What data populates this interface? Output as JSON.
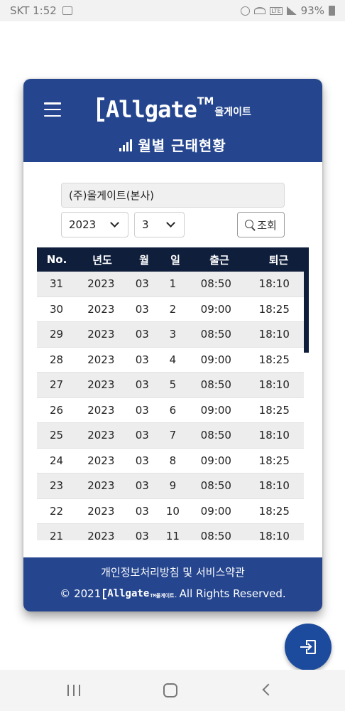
{
  "status_bar": {
    "carrier_time": "SKT 1:52",
    "battery": "93%"
  },
  "header": {
    "logo_text": "Allgate",
    "logo_tm": "TM",
    "logo_kr": "올게이트",
    "title": "월별 근태현황"
  },
  "form": {
    "company": "(주)올게이트(본사)",
    "year": "2023",
    "month": "3",
    "search_label": "조회"
  },
  "table": {
    "columns": [
      "No.",
      "년도",
      "월",
      "일",
      "출근",
      "퇴근"
    ],
    "rows": [
      [
        "31",
        "2023",
        "03",
        "1",
        "08:50",
        "18:10"
      ],
      [
        "30",
        "2023",
        "03",
        "2",
        "09:00",
        "18:25"
      ],
      [
        "29",
        "2023",
        "03",
        "3",
        "08:50",
        "18:10"
      ],
      [
        "28",
        "2023",
        "03",
        "4",
        "09:00",
        "18:25"
      ],
      [
        "27",
        "2023",
        "03",
        "5",
        "08:50",
        "18:10"
      ],
      [
        "26",
        "2023",
        "03",
        "6",
        "09:00",
        "18:25"
      ],
      [
        "25",
        "2023",
        "03",
        "7",
        "08:50",
        "18:10"
      ],
      [
        "24",
        "2023",
        "03",
        "8",
        "09:00",
        "18:25"
      ],
      [
        "23",
        "2023",
        "03",
        "9",
        "08:50",
        "18:10"
      ],
      [
        "22",
        "2023",
        "03",
        "10",
        "09:00",
        "18:25"
      ],
      [
        "21",
        "2023",
        "03",
        "11",
        "08:50",
        "18:10"
      ]
    ]
  },
  "footer": {
    "policy": "개인정보처리방침 및 서비스약관",
    "copyright_prefix": "© 2021",
    "mini_logo": "Allgate",
    "mini_logo_tm": "TM올게이트.",
    "copyright_suffix": "All Rights Reserved."
  },
  "icons": {
    "menu": "hamburger-menu-icon",
    "chart": "bar-chart-icon",
    "search": "search-icon",
    "logout": "exit-icon",
    "nav_recent": "recent-apps-icon",
    "nav_home": "home-icon",
    "nav_back": "back-icon"
  },
  "colors": {
    "header_bg": "#25468f",
    "table_header_bg": "#0f1e3b",
    "fab_bg": "#1c4a9c"
  }
}
